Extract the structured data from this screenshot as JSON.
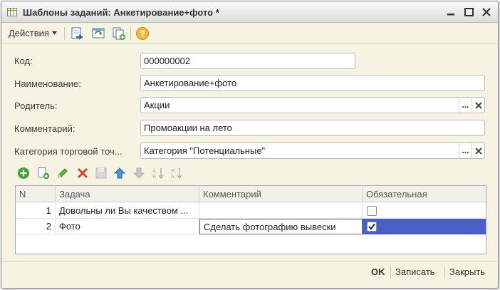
{
  "window": {
    "title": "Шаблоны заданий: Анкетирование+фото *"
  },
  "toolbar": {
    "actions_label": "Действия",
    "icons": [
      "document-arrow-icon",
      "refresh-table-icon",
      "copy-add-icon",
      "help-icon"
    ]
  },
  "form": {
    "code_label": "Код:",
    "code_value": "000000002",
    "name_label": "Наименование:",
    "name_value": "Анкетирование+фото",
    "parent_label": "Родитель:",
    "parent_value": "Акции",
    "comment_label": "Комментарий:",
    "comment_value": "Промоакции на лето",
    "category_label": "Категория торговой точ...",
    "category_value": "Категория \"Потенциальные\"",
    "select_glyph": "...",
    "clear_glyph": "✕"
  },
  "table": {
    "columns": [
      "N",
      "Задача",
      "Комментарий",
      "Обязательная"
    ],
    "rows": [
      {
        "n": "1",
        "task": "Довольны ли Вы качеством ...",
        "comment": "",
        "required": false
      },
      {
        "n": "2",
        "task": "Фото",
        "comment": "Сделать фотографию вывески",
        "required": true
      }
    ]
  },
  "footer": {
    "ok_label": "OK",
    "save_label": "Записать",
    "close_label": "Закрыть"
  },
  "colors": {
    "window_bg": "#f6f3e2",
    "selected_row": "#4a5ec7",
    "add_green": "#3fa33a",
    "delete_red": "#d9412f",
    "up_blue": "#4f8fd6"
  }
}
